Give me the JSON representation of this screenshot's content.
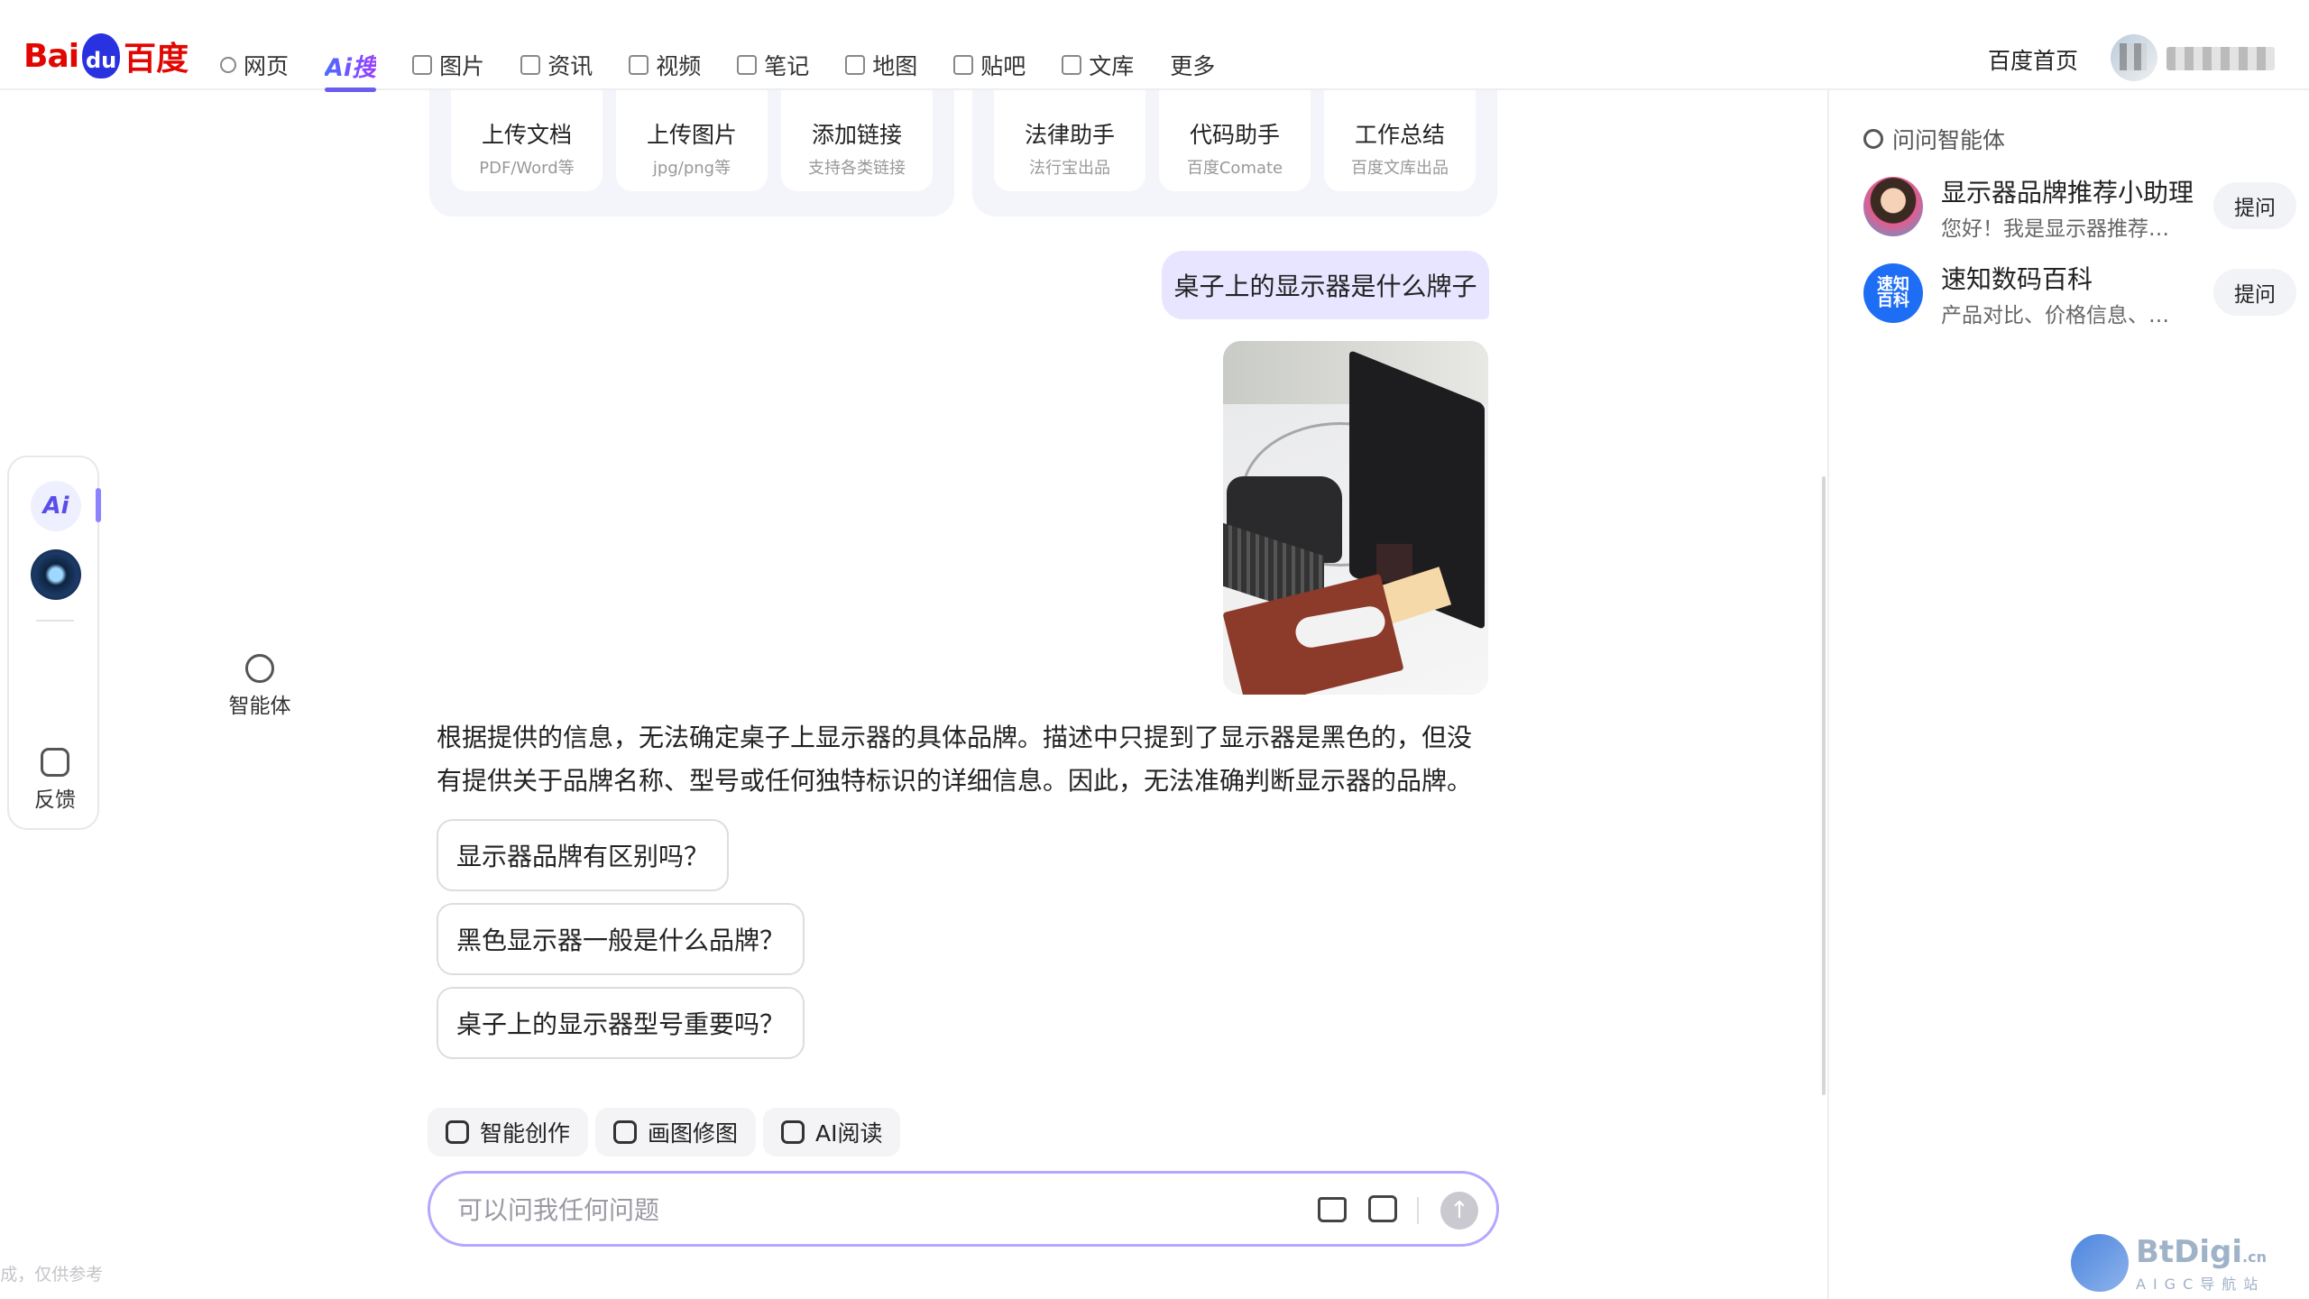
{
  "brand": {
    "logo_left": "Bai",
    "logo_paw": "du",
    "logo_right": "百度"
  },
  "nav": {
    "items": [
      {
        "label": "网页",
        "icon": "search-icon"
      },
      {
        "label": "Ai搜",
        "icon": "ai-search-icon",
        "active": true
      },
      {
        "label": "图片",
        "icon": "image-icon"
      },
      {
        "label": "资讯",
        "icon": "news-icon"
      },
      {
        "label": "视频",
        "icon": "video-icon"
      },
      {
        "label": "笔记",
        "icon": "note-icon"
      },
      {
        "label": "地图",
        "icon": "map-icon"
      },
      {
        "label": "贴吧",
        "icon": "tieba-icon"
      },
      {
        "label": "文库",
        "icon": "library-icon"
      },
      {
        "label": "更多",
        "icon": ""
      }
    ],
    "home_label": "百度首页"
  },
  "leftbar": {
    "ai_label": "Ai",
    "agent_label": "智能体",
    "feedback_label": "反馈"
  },
  "upload_tools": [
    {
      "title": "上传文档",
      "sub": "PDF/Word等"
    },
    {
      "title": "上传图片",
      "sub": "jpg/png等"
    },
    {
      "title": "添加链接",
      "sub": "支持各类链接"
    }
  ],
  "assistants": [
    {
      "title": "法律助手",
      "sub": "法行宝出品"
    },
    {
      "title": "代码助手",
      "sub": "百度Comate"
    },
    {
      "title": "工作总结",
      "sub": "百度文库出品"
    }
  ],
  "chat": {
    "user_message": "桌子上的显示器是什么牌子",
    "answer": "根据提供的信息，无法确定桌子上显示器的具体品牌。描述中只提到了显示器是黑色的，但没有提供关于品牌名称、型号或任何独特标识的详细信息。因此，无法准确判断显示器的品牌。",
    "suggestions": [
      "显示器品牌有区别吗？",
      "黑色显示器一般是什么品牌？",
      "桌子上的显示器型号重要吗？"
    ]
  },
  "skills": [
    {
      "label": "智能创作",
      "icon": "edit-icon"
    },
    {
      "label": "画图修图",
      "icon": "picture-icon"
    },
    {
      "label": "AI阅读",
      "icon": "book-icon"
    }
  ],
  "input": {
    "placeholder": "可以问我任何问题",
    "value": ""
  },
  "disclaimer": "内容由AI生成，仅供参考",
  "right_panel": {
    "title": "问问智能体",
    "agents": [
      {
        "name": "显示器品牌推荐小助理",
        "desc": "您好！我是显示器推荐…",
        "ask": "提问"
      },
      {
        "name": "速知数码百科",
        "desc": "产品对比、价格信息、…",
        "ask": "提问",
        "avatar_text": "速知百科"
      }
    ]
  },
  "watermark": {
    "title": "BtDigi",
    "suffix": ".cn",
    "sub": "AIGC导航站"
  },
  "colors": {
    "accent": "#6a5cf0",
    "brand_red": "#e10602",
    "brand_blue": "#2932e1",
    "user_bubble": "#e7e5ff"
  }
}
